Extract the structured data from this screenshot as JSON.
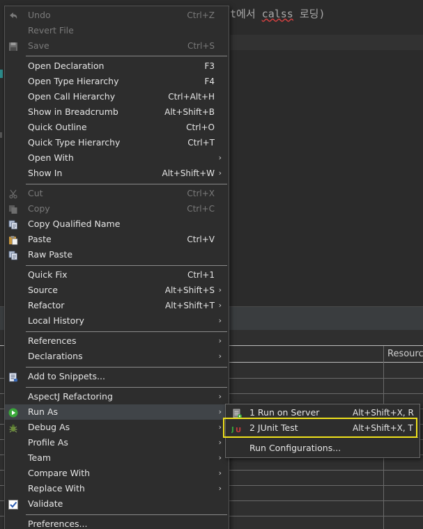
{
  "editor": {
    "code_prefix": "t에서 ",
    "code_squiggle": "calss",
    "code_suffix": " 로딩)"
  },
  "panel": {
    "column_header": "Resourc"
  },
  "context_menu": {
    "items": [
      {
        "label": "Undo",
        "shortcut": "Ctrl+Z",
        "disabled": true,
        "icon": "undo-arrow-icon"
      },
      {
        "label": "Revert File",
        "shortcut": "",
        "disabled": true
      },
      {
        "label": "Save",
        "shortcut": "Ctrl+S",
        "disabled": true,
        "icon": "floppy-disk-icon"
      },
      {
        "label": "Open Declaration",
        "shortcut": "F3"
      },
      {
        "label": "Open Type Hierarchy",
        "shortcut": "F4"
      },
      {
        "label": "Open Call Hierarchy",
        "shortcut": "Ctrl+Alt+H"
      },
      {
        "label": "Show in Breadcrumb",
        "shortcut": "Alt+Shift+B"
      },
      {
        "label": "Quick Outline",
        "shortcut": "Ctrl+O"
      },
      {
        "label": "Quick Type Hierarchy",
        "shortcut": "Ctrl+T"
      },
      {
        "label": "Open With",
        "submenu": true
      },
      {
        "label": "Show In",
        "shortcut": "Alt+Shift+W",
        "submenu": true
      },
      {
        "label": "Cut",
        "shortcut": "Ctrl+X",
        "disabled": true,
        "icon": "scissors-icon"
      },
      {
        "label": "Copy",
        "shortcut": "Ctrl+C",
        "disabled": true,
        "icon": "copy-icon"
      },
      {
        "label": "Copy Qualified Name",
        "icon": "copy-qualified-name-icon"
      },
      {
        "label": "Paste",
        "shortcut": "Ctrl+V",
        "icon": "paste-clipboard-icon"
      },
      {
        "label": "Raw Paste",
        "icon": "raw-paste-icon"
      },
      {
        "label": "Quick Fix",
        "shortcut": "Ctrl+1"
      },
      {
        "label": "Source",
        "shortcut": "Alt+Shift+S",
        "submenu": true
      },
      {
        "label": "Refactor",
        "shortcut": "Alt+Shift+T",
        "submenu": true
      },
      {
        "label": "Local History",
        "submenu": true
      },
      {
        "label": "References",
        "submenu": true
      },
      {
        "label": "Declarations",
        "submenu": true
      },
      {
        "label": "Add to Snippets...",
        "icon": "snippet-icon"
      },
      {
        "label": "AspectJ Refactoring",
        "submenu": true
      },
      {
        "label": "Run As",
        "submenu": true,
        "selected": true,
        "icon": "run-green-icon"
      },
      {
        "label": "Debug As",
        "submenu": true,
        "icon": "debug-bug-icon"
      },
      {
        "label": "Profile As",
        "submenu": true
      },
      {
        "label": "Team",
        "submenu": true
      },
      {
        "label": "Compare With",
        "submenu": true
      },
      {
        "label": "Replace With",
        "submenu": true
      },
      {
        "label": "Validate",
        "icon": "checkbox-checked-icon"
      },
      {
        "label": "Preferences..."
      }
    ]
  },
  "run_as_submenu": {
    "items": [
      {
        "label": "1 Run on Server",
        "shortcut": "Alt+Shift+X, R",
        "icon": "server-icon"
      },
      {
        "label": "2 JUnit Test",
        "shortcut": "Alt+Shift+X, T",
        "icon": "junit-icon",
        "highlighted": true
      },
      {
        "label": "Run Configurations..."
      }
    ]
  },
  "colors": {
    "highlight_box": "#f0e21c",
    "menu_bg": "#2d2d2d",
    "selected_bg": "#404448"
  }
}
